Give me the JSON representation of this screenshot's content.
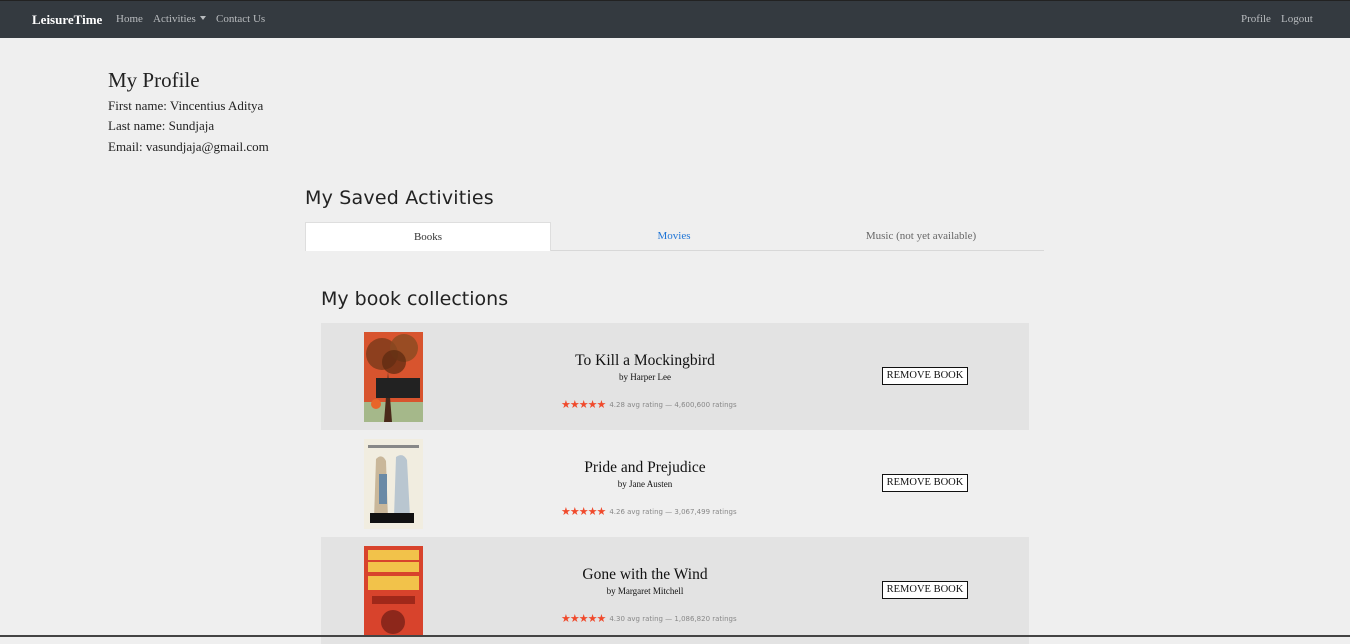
{
  "navbar": {
    "brand": "LeisureTime",
    "links": [
      "Home",
      "Activities",
      "Contact Us"
    ],
    "right_links": [
      "Profile",
      "Logout"
    ]
  },
  "profile": {
    "title": "My Profile",
    "first_name": "First name: Vincentius Aditya",
    "last_name": "Last name: Sundjaja",
    "email": "Email: vasundjaja@gmail.com"
  },
  "saved": {
    "title": "My Saved Activities",
    "tabs": [
      "Books",
      "Movies",
      "Music (not yet available)"
    ],
    "active_tab": "Books"
  },
  "collection": {
    "title": "My book collections",
    "remove_label": "REMOVE BOOK",
    "books": [
      {
        "title": "To Kill a Mockingbird",
        "author": "by Harper Lee",
        "rating_text": "4.28 avg rating — 4,600,600 ratings",
        "rating": 4.28,
        "cover_color": "#d8542e"
      },
      {
        "title": "Pride and Prejudice",
        "author": "by Jane Austen",
        "rating_text": "4.26 avg rating — 3,067,499 ratings",
        "rating": 4.26,
        "cover_color": "#f1ede0"
      },
      {
        "title": "Gone with the Wind",
        "author": "by Margaret Mitchell",
        "rating_text": "4.30 avg rating — 1,086,820 ratings",
        "rating": 4.3,
        "cover_color": "#d8432c"
      }
    ]
  },
  "colors": {
    "navbar_bg": "#343a40",
    "page_bg": "#efefef",
    "link_blue": "#1e74d6",
    "star_color": "#f04a2c"
  }
}
